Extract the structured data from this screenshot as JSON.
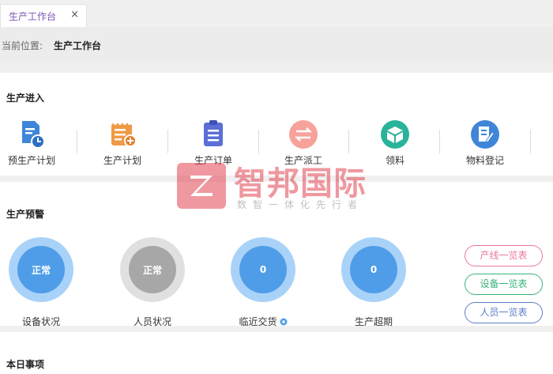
{
  "tabs": [
    {
      "label": "生产工作台",
      "close": "×"
    }
  ],
  "breadcrumb": {
    "prefix": "当前位置:",
    "current": "生产工作台"
  },
  "entry_section": {
    "title": "生产进入",
    "items": [
      {
        "label": "预生产计划",
        "icon": "document-clock-icon",
        "color": "#3f86d9"
      },
      {
        "label": "生产计划",
        "icon": "calendar-plus-icon",
        "color": "#f09a45"
      },
      {
        "label": "生产订单",
        "icon": "clipboard-list-icon",
        "color": "#5b6fd6"
      },
      {
        "label": "生产派工",
        "icon": "swap-arrows-icon",
        "color": "#f7a29a"
      },
      {
        "label": "领料",
        "icon": "box-icon",
        "color": "#2ab39b"
      },
      {
        "label": "物料登记",
        "icon": "edit-note-icon",
        "color": "#3f86d9"
      }
    ]
  },
  "warning_section": {
    "title": "生产预警",
    "gauges": [
      {
        "label": "设备状况",
        "value": "正常",
        "ring": "#a9d2f8",
        "fill": "#4f9de8"
      },
      {
        "label": "人员状况",
        "value": "正常",
        "ring": "#e0e0e0",
        "fill": "#a7a7a7"
      },
      {
        "label": "临近交货",
        "value": "0",
        "ring": "#a9d2f8",
        "fill": "#4f9de8",
        "info_icon": "info-gear-icon"
      },
      {
        "label": "生产超期",
        "value": "0",
        "ring": "#a9d2f8",
        "fill": "#4f9de8"
      }
    ],
    "buttons": [
      {
        "label": "产线一览表",
        "color": "#e8799a"
      },
      {
        "label": "设备一览表",
        "color": "#38b37a"
      },
      {
        "label": "人员一览表",
        "color": "#5b7fc7"
      }
    ]
  },
  "today_section": {
    "title": "本日事项"
  },
  "watermark": {
    "main": "智邦国际",
    "sub": "数智一体化先行者"
  }
}
